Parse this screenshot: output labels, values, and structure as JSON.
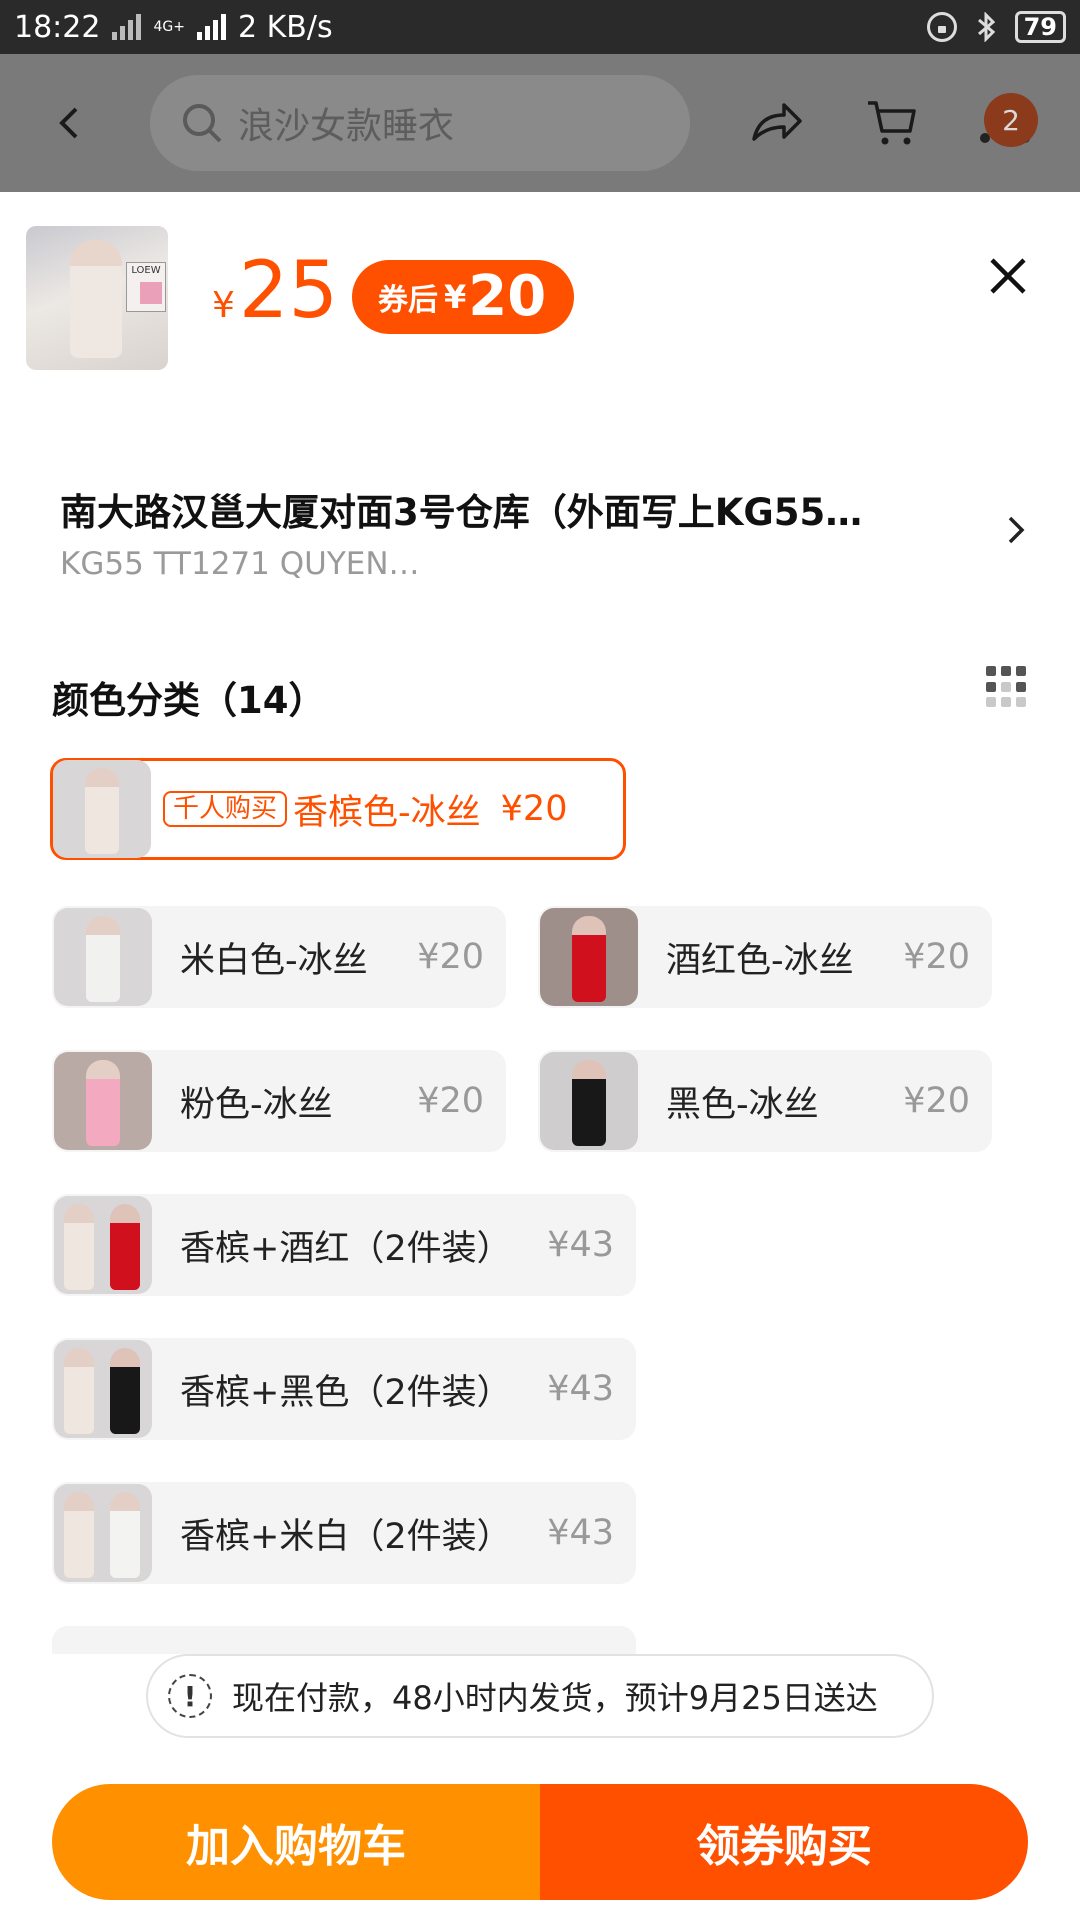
{
  "status_bar": {
    "time": "18:22",
    "network_type": "4G+",
    "speed": "2 KB/s",
    "battery": "79"
  },
  "top_nav": {
    "search_placeholder": "浪沙女款睡衣",
    "more_badge": "2"
  },
  "sku_panel": {
    "price_currency": "¥",
    "price": "25",
    "coupon_label": "券后",
    "coupon_currency": "¥",
    "coupon_price": "20"
  },
  "address": {
    "line1": "南大路汉邕大厦对面3号仓库（外面写上KG55…",
    "line2": "KG55 TT1271 QUYEN…"
  },
  "options": {
    "title": "颜色分类（14）",
    "hot_tag": "千人购买",
    "items": [
      {
        "name": "香槟色-冰丝",
        "price": "¥20"
      },
      {
        "name": "米白色-冰丝",
        "price": "¥20"
      },
      {
        "name": "酒红色-冰丝",
        "price": "¥20"
      },
      {
        "name": "粉色-冰丝",
        "price": "¥20"
      },
      {
        "name": "黑色-冰丝",
        "price": "¥20"
      },
      {
        "name": "香槟+酒红（2件装）",
        "price": "¥43"
      },
      {
        "name": "香槟+黑色（2件装）",
        "price": "¥43"
      },
      {
        "name": "香槟+米白（2件装）",
        "price": "¥43"
      }
    ]
  },
  "notice": {
    "icon_text": "!",
    "text": "现在付款，48小时内发货，预计9月25日送达"
  },
  "actions": {
    "add_to_cart": "加入购物车",
    "buy_with_coupon": "领券购买"
  },
  "colors": {
    "accent": "#ff5000",
    "cart_button": "#ff9000"
  }
}
